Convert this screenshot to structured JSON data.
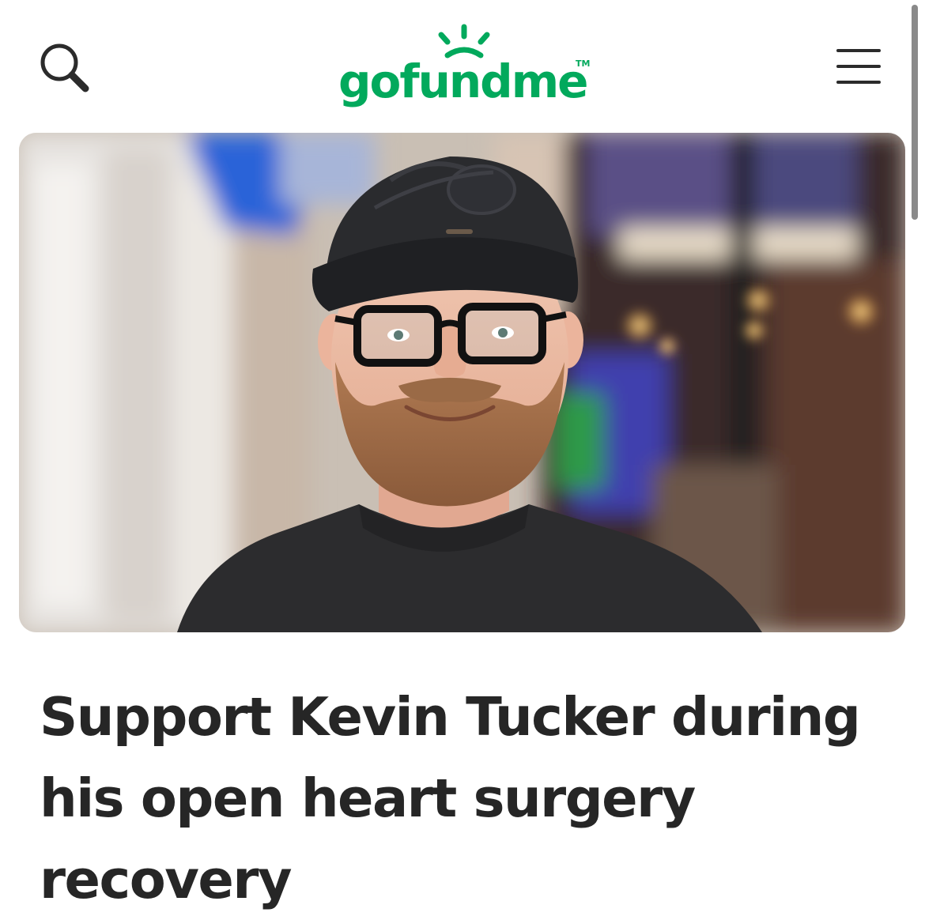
{
  "header": {
    "logo_text": "gofundme",
    "logo_tm": "TM",
    "brand_color": "#02a95c",
    "search_icon": "search-icon",
    "menu_icon": "hamburger-menu-icon"
  },
  "hero": {
    "image": "photo-of-smiling-man-in-black-cap-and-glasses"
  },
  "campaign": {
    "title": "Support Kevin Tucker during his open heart surgery recovery"
  }
}
